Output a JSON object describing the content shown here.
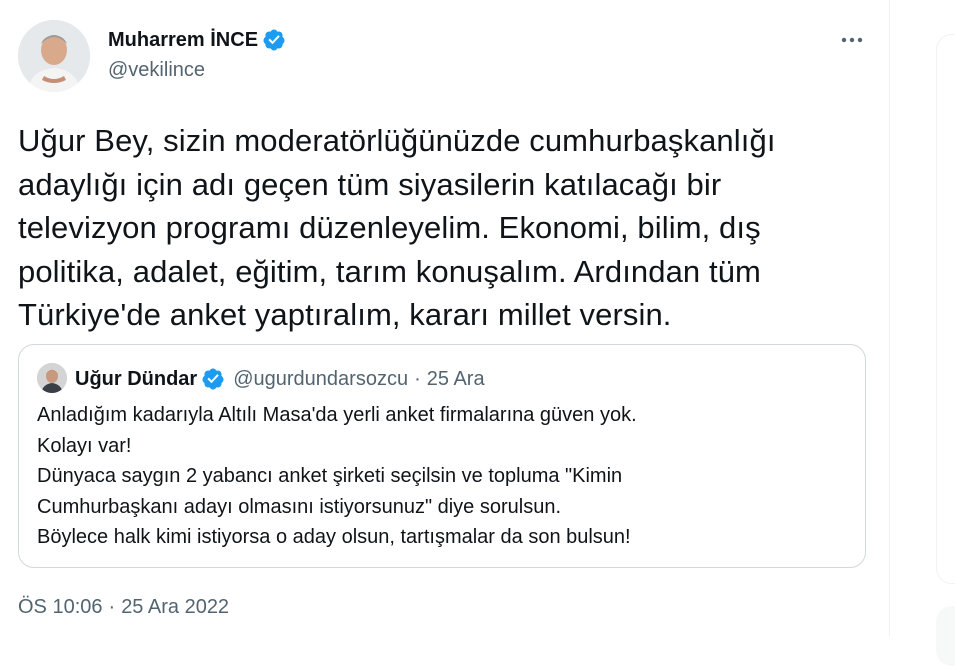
{
  "tweet": {
    "author": {
      "name": "Muharrem İNCE",
      "handle": "@vekilince",
      "verified": true
    },
    "more_icon": "more-dots-icon",
    "text": "Uğur Bey, sizin moderatörlüğünüzde cumhurbaşkanlığı\nadaylığı için adı geçen tüm siyasilerin katılacağı bir\ntelevizyon programı düzenleyelim. Ekonomi, bilim, dış\npolitika, adalet, eğitim, tarım konuşalım. Ardından tüm\nTürkiye'de anket yaptıralım, kararı millet versin.",
    "quote": {
      "name": "Uğur Dündar",
      "verified": true,
      "handle": "@ugurdundarsozcu",
      "separator": "·",
      "date": "25 Ara",
      "text": "Anladığım kadarıyla Altılı Masa'da yerli anket firmalarına güven yok.\nKolayı var!\nDünyaca saygın 2 yabancı anket şirketi seçilsin ve topluma \"Kimin\nCumhurbaşkanı adayı olmasını istiyorsunuz\" diye sorulsun.\nBöylece halk kimi istiyorsa o aday olsun, tartışmalar da son bulsun!"
    },
    "timestamp": {
      "time": "ÖS 10:06",
      "separator": "·",
      "date": "25 Ara 2022"
    }
  },
  "colors": {
    "text_primary": "#0f1419",
    "text_secondary": "#536471",
    "verified_blue": "#1d9bf0",
    "border": "#cfd9de"
  }
}
